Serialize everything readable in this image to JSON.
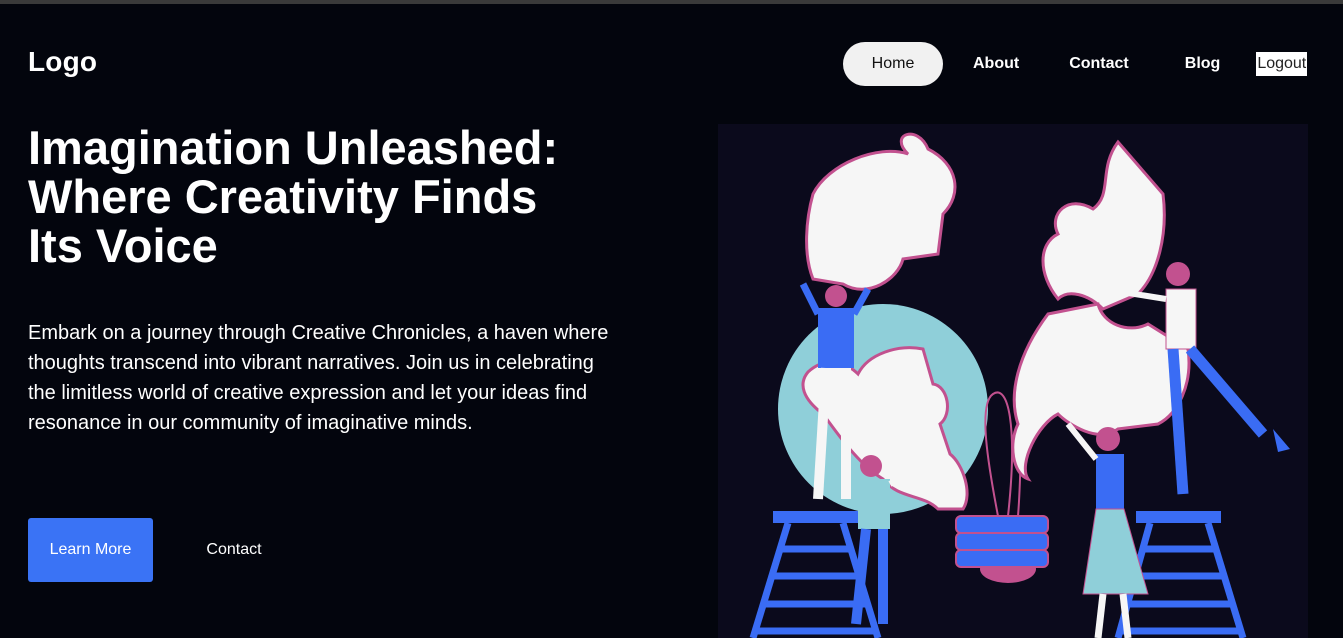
{
  "brand": {
    "logo_text": "Logo"
  },
  "nav": {
    "items": [
      {
        "label": "Home",
        "active": true
      },
      {
        "label": "About"
      },
      {
        "label": "Contact"
      },
      {
        "label": "Blog"
      }
    ],
    "logout_label": "Logout"
  },
  "hero": {
    "title_lines": [
      "Imagination Unleashed:",
      "Where Creativity Finds",
      "Its Voice"
    ],
    "description": "Embark on a journey through Creative Chronicles, a haven where thoughts transcend into vibrant narratives. Join us in celebrating the limitless world of creative expression and let your ideas find resonance in our community of imaginative minds.",
    "primary_button": "Learn More",
    "secondary_button": "Contact"
  },
  "colors": {
    "background": "#03050d",
    "accent": "#3a73f5",
    "illustration_bg": "#0b0a1c",
    "puzzle_outline": "#c2518f",
    "teal_circle": "#8fcfd9",
    "figure_blue": "#3a6cf4"
  },
  "illustration": {
    "icon": "puzzle-team-illustration"
  }
}
